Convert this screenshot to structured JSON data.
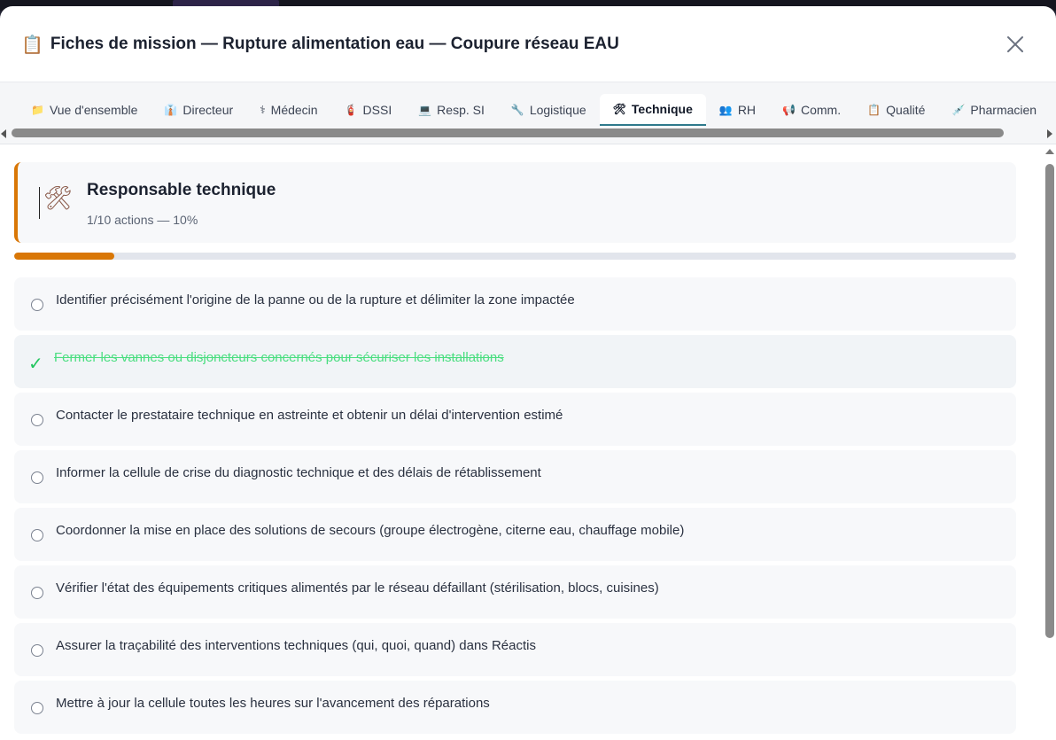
{
  "modal": {
    "title_icon": "📋",
    "title": "Fiches de mission — Rupture alimentation eau — Coupure réseau EAU",
    "close_icon": "close-icon"
  },
  "tabs": [
    {
      "icon": "📁",
      "label": "Vue d'ensemble",
      "active": false
    },
    {
      "icon": "👔",
      "label": "Directeur",
      "active": false
    },
    {
      "icon": "⚕",
      "label": "Médecin",
      "active": false
    },
    {
      "icon": "🧯",
      "label": "DSSI",
      "active": false
    },
    {
      "icon": "💻",
      "label": "Resp. SI",
      "active": false
    },
    {
      "icon": "🔧",
      "label": "Logistique",
      "active": false
    },
    {
      "icon": "🛠",
      "label": "Technique",
      "active": true
    },
    {
      "icon": "👥",
      "label": "RH",
      "active": false
    },
    {
      "icon": "📢",
      "label": "Comm.",
      "active": false
    },
    {
      "icon": "📋",
      "label": "Qualité",
      "active": false
    },
    {
      "icon": "💉",
      "label": "Pharmacien",
      "active": false
    }
  ],
  "role": {
    "icon": "🛠",
    "title": "Responsable technique",
    "summary": "1/10 actions — 10%",
    "progress_fraction": 0.1,
    "accent_color": "#d97706"
  },
  "actions": [
    {
      "label": "Identifier précisément l'origine de la panne ou de la rupture et délimiter la zone impactée",
      "done": false
    },
    {
      "label": "Fermer les vannes ou disjoncteurs concernés pour sécuriser les installations",
      "done": true
    },
    {
      "label": "Contacter le prestataire technique en astreinte et obtenir un délai d'intervention estimé",
      "done": false
    },
    {
      "label": "Informer la cellule de crise du diagnostic technique et des délais de rétablissement",
      "done": false
    },
    {
      "label": "Coordonner la mise en place des solutions de secours (groupe électrogène, citerne eau, chauffage mobile)",
      "done": false
    },
    {
      "label": "Vérifier l'état des équipements critiques alimentés par le réseau défaillant (stérilisation, blocs, cuisines)",
      "done": false
    },
    {
      "label": "Assurer la traçabilité des interventions techniques (qui, quoi, quand) dans Réactis",
      "done": false
    },
    {
      "label": "Mettre à jour la cellule toutes les heures sur l'avancement des réparations",
      "done": false
    }
  ],
  "done_check_glyph": "✓"
}
